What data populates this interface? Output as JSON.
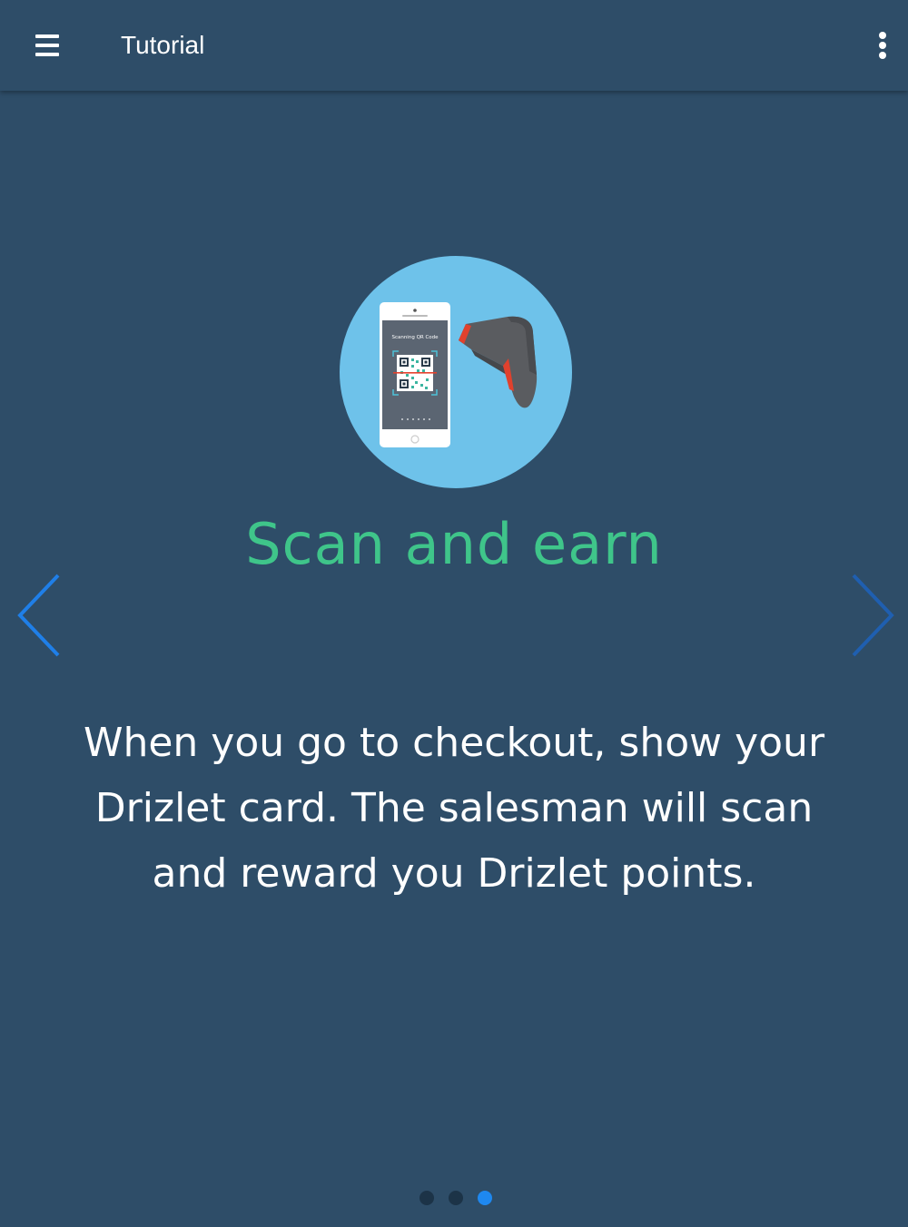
{
  "appbar": {
    "title": "Tutorial",
    "menu_icon": "hamburger-menu-icon",
    "more_icon": "more-vert-icon"
  },
  "slide": {
    "title": "Scan and earn",
    "body": "When you go to checkout, show your Drizlet card. The salesman will scan and reward you Drizlet points.",
    "phone_caption": "Scanning QR Code",
    "prev_icon": "chevron-left-icon",
    "next_icon": "chevron-right-icon"
  },
  "pagination": {
    "total": 3,
    "active_index": 2
  },
  "colors": {
    "background": "#2e4d68",
    "title_green": "#3fc58a",
    "arrow_prev": "#1f7fe8",
    "arrow_next": "#1f5fb0",
    "dot_inactive": "#1c3347",
    "dot_active": "#1e88f0",
    "circle": "#6ec2ea"
  }
}
